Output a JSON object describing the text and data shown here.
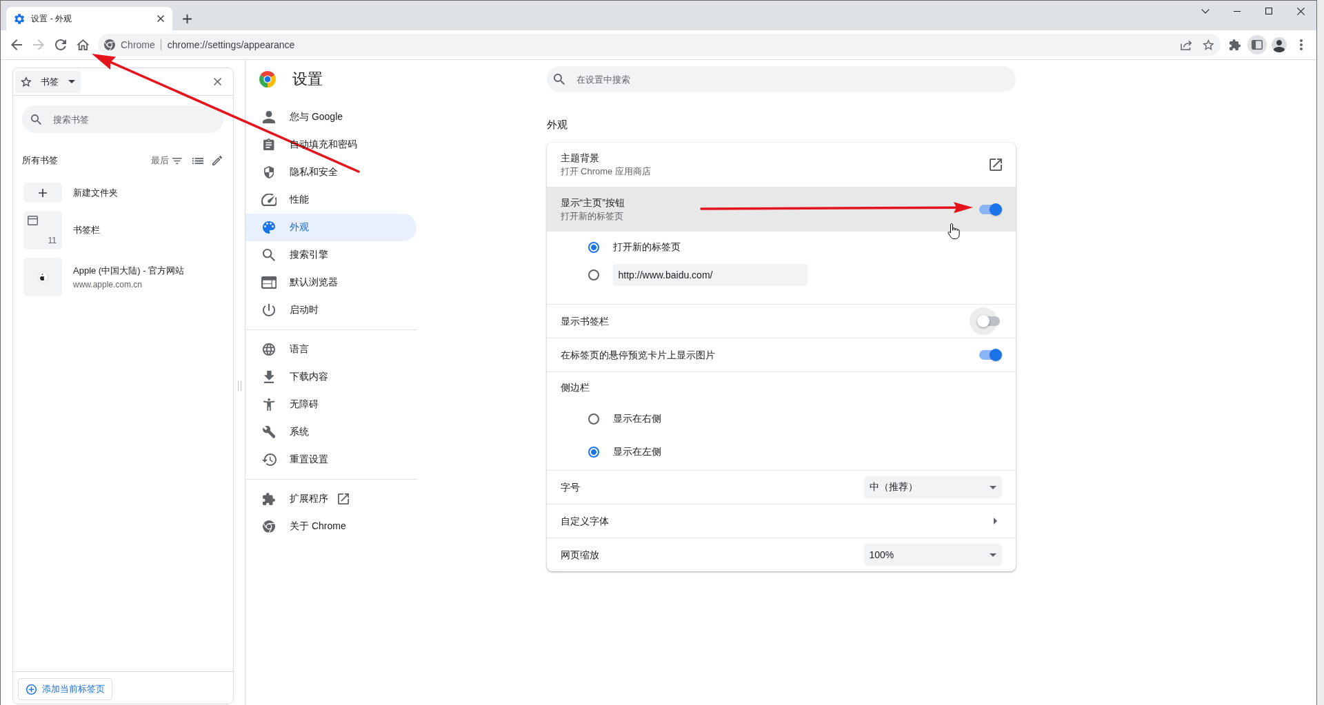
{
  "browser": {
    "tabs": [
      {
        "title": "设置 - 外观",
        "selected": true
      }
    ],
    "toolbar": {
      "forward_disabled": true,
      "side_panel_active": true
    },
    "address_bar": {
      "site_label": "Chrome",
      "url": "chrome://settings/appearance"
    }
  },
  "bookmarks_panel": {
    "title": "书签",
    "search": {
      "placeholder": "搜索书签"
    },
    "section_label": "所有书签",
    "sort_label": "最后",
    "items": [
      {
        "kind": "new_folder",
        "title": "新建文件夹"
      },
      {
        "kind": "folder",
        "title": "书签栏",
        "count": "11"
      },
      {
        "kind": "site",
        "title": "Apple (中国大陆) - 官方网站",
        "url": "www.apple.com.cn"
      }
    ],
    "add_button": "添加当前标签页"
  },
  "settings": {
    "title": "设置",
    "search": {
      "placeholder": "在设置中搜索"
    },
    "nav": [
      {
        "items": [
          {
            "kind": "page",
            "label": "您与 Google",
            "selected": false
          },
          {
            "kind": "page",
            "label": "自动填充和密码",
            "selected": false
          },
          {
            "kind": "page",
            "label": "隐私和安全",
            "selected": false
          },
          {
            "kind": "page",
            "label": "性能",
            "selected": false
          },
          {
            "kind": "page",
            "label": "外观",
            "selected": true
          },
          {
            "kind": "page",
            "label": "搜索引擎",
            "selected": false
          },
          {
            "kind": "page",
            "label": "默认浏览器",
            "selected": false
          },
          {
            "kind": "page",
            "label": "启动时",
            "selected": false
          }
        ]
      },
      {
        "items": [
          {
            "kind": "page",
            "label": "语言",
            "selected": false
          },
          {
            "kind": "page",
            "label": "下载内容",
            "selected": false
          },
          {
            "kind": "page",
            "label": "无障碍",
            "selected": false
          },
          {
            "kind": "page",
            "label": "系统",
            "selected": false
          },
          {
            "kind": "page",
            "label": "重置设置",
            "selected": false
          }
        ]
      },
      {
        "items": [
          {
            "kind": "external",
            "label": "扩展程序",
            "selected": false
          },
          {
            "kind": "page",
            "label": "关于 Chrome",
            "selected": false
          }
        ]
      }
    ],
    "section_title": "外观",
    "rows": [
      {
        "kind": "link",
        "title": "主题背景",
        "subtitle": "打开 Chrome 应用商店"
      },
      {
        "kind": "toggle",
        "title": "显示“主页”按钮",
        "subtitle": "打开新的标签页",
        "on": true,
        "hovered": true,
        "focused": false
      },
      {
        "kind": "radio_group",
        "options": [
          {
            "kind": "label",
            "label": "打开新的标签页",
            "selected": true
          },
          {
            "kind": "input",
            "value": "http://www.baidu.com/",
            "selected": false
          }
        ]
      },
      {
        "kind": "toggle",
        "title": "显示书签栏",
        "on": false,
        "hovered": false,
        "focused": true
      },
      {
        "kind": "toggle",
        "title": "在标签页的悬停预览卡片上显示图片",
        "on": true,
        "hovered": false,
        "focused": false
      },
      {
        "kind": "radio_group",
        "title": "侧边栏",
        "options": [
          {
            "kind": "label",
            "label": "显示在右侧",
            "selected": false
          },
          {
            "kind": "label",
            "label": "显示在左侧",
            "selected": true
          }
        ]
      },
      {
        "kind": "select",
        "title": "字号",
        "value": "中（推荐）"
      },
      {
        "kind": "submenu",
        "title": "自定义字体"
      },
      {
        "kind": "select",
        "title": "网页缩放",
        "value": "100%"
      }
    ]
  }
}
